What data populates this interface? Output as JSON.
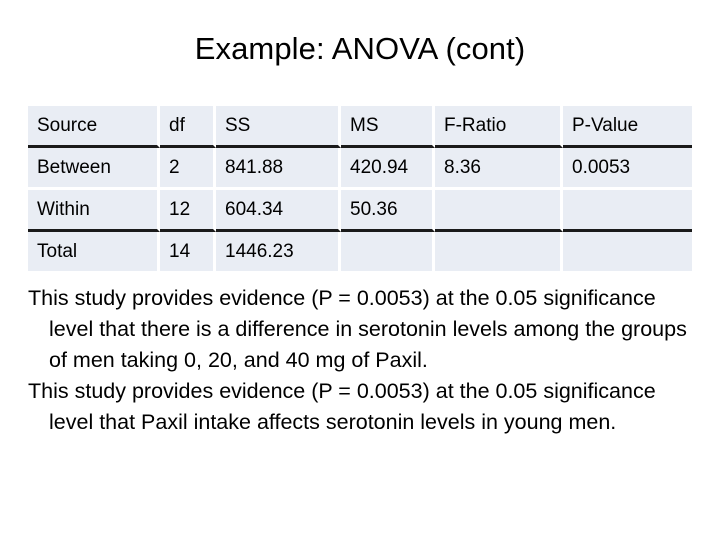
{
  "slide": {
    "title": "Example: ANOVA (cont)",
    "background_color": "#ffffff",
    "text_color": "#000000"
  },
  "table": {
    "cell_background": "#e9edf4",
    "rule_color": "#1a1a1a",
    "columns": [
      "Source",
      "df",
      "SS",
      "MS",
      "F-Ratio",
      "P-Value"
    ],
    "rows": [
      {
        "source": "Between",
        "df": "2",
        "ss": "841.88",
        "ms": "420.94",
        "f_ratio": "8.36",
        "p_value": "0.0053"
      },
      {
        "source": "Within",
        "df": "12",
        "ss": "604.34",
        "ms": "50.36",
        "f_ratio": "",
        "p_value": ""
      },
      {
        "source": "Total",
        "df": "14",
        "ss": "1446.23",
        "ms": "",
        "f_ratio": "",
        "p_value": ""
      }
    ]
  },
  "body": {
    "paragraph_1": "This study provides evidence (P = 0.0053) at the 0.05 significance level that there is a difference in serotonin levels among the groups of men taking 0, 20, and 40 mg of Paxil.",
    "paragraph_2": "This study provides evidence (P = 0.0053) at the 0.05 significance level that Paxil intake affects serotonin levels in young men."
  },
  "chart_data": {
    "type": "table",
    "title": "Example: ANOVA (cont)",
    "columns": [
      "Source",
      "df",
      "SS",
      "MS",
      "F-Ratio",
      "P-Value"
    ],
    "rows": [
      [
        "Between",
        2,
        841.88,
        420.94,
        8.36,
        0.0053
      ],
      [
        "Within",
        12,
        604.34,
        50.36,
        null,
        null
      ],
      [
        "Total",
        14,
        1446.23,
        null,
        null,
        null
      ]
    ],
    "notes": [
      "P-value = 0.0053",
      "Significance level = 0.05",
      "Paxil doses compared: 0, 20, and 40 mg"
    ]
  }
}
